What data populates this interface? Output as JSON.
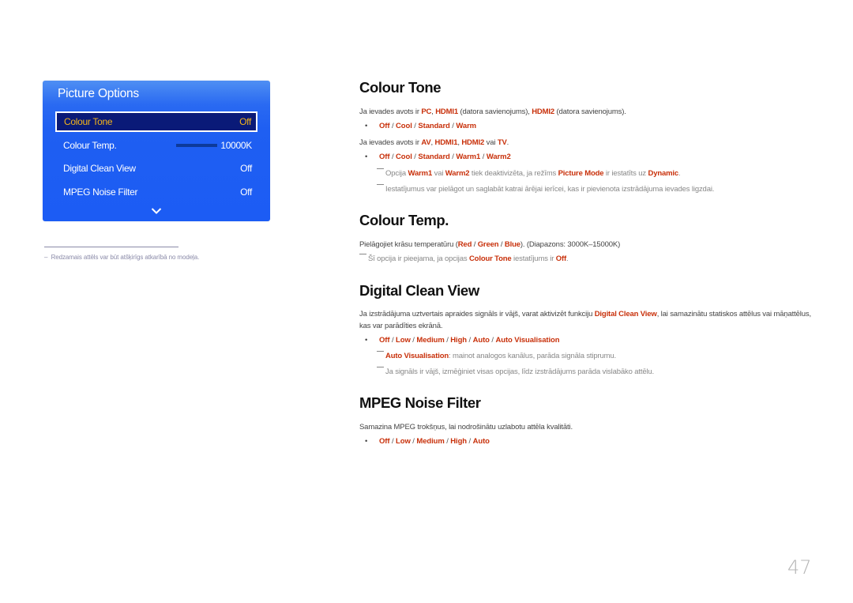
{
  "osd": {
    "title": "Picture Options",
    "items": [
      {
        "label": "Colour Tone",
        "value": "Off",
        "selected": true
      },
      {
        "label": "Colour Temp.",
        "value": "10000K",
        "slider_fraction": 1.0
      },
      {
        "label": "Digital Clean View",
        "value": "Off"
      },
      {
        "label": "MPEG Noise Filter",
        "value": "Off"
      }
    ],
    "more_icon": "chevron-down-icon"
  },
  "footnote": {
    "dash": "–",
    "text": "Redzamais attēls var būt atšķirīgs atkarībā no modeļa."
  },
  "sections": {
    "colour_tone": {
      "heading": "Colour Tone",
      "line1": {
        "t1": "Ja ievades avots ir ",
        "h1": "PC",
        "t2": ", ",
        "h2": "HDMI1",
        "t3": " (datora savienojums), ",
        "h3": "HDMI2",
        "t4": " (datora savienojums)."
      },
      "options1": [
        "Off",
        "Cool",
        "Standard",
        "Warm"
      ],
      "line2": {
        "t1": "Ja ievades avots ir ",
        "h1": "AV",
        "t2": ", ",
        "h2": "HDMI1",
        "t3": ", ",
        "h3": "HDMI2",
        "t4": " vai ",
        "h4": "TV",
        "t5": "."
      },
      "options2": [
        "Off",
        "Cool",
        "Standard",
        "Warm1",
        "Warm2"
      ],
      "note1": {
        "t1": "Opcija ",
        "h1": "Warm1",
        "t2": " vai ",
        "h2": "Warm2",
        "t3": " tiek deaktivizēta, ja režīms ",
        "h3": "Picture Mode",
        "t4": " ir iestatīts uz ",
        "h4": "Dynamic",
        "t5": "."
      },
      "note2": "Iestatījumus var pielāgot un saglabāt katrai ārējai ierīcei, kas ir pievienota izstrādājuma ievades ligzdai."
    },
    "colour_temp": {
      "heading": "Colour Temp.",
      "line1": {
        "t1": "Pielāgojiet krāsu temperatūru (",
        "h1": "Red",
        "t2": " / ",
        "h2": "Green",
        "t3": " / ",
        "h3": "Blue",
        "t4": "). (Diapazons: 3000K–15000K)"
      },
      "note1": {
        "t1": "Šī opcija ir pieejama, ja opcijas ",
        "h1": "Colour Tone",
        "t2": " iestatījums ir ",
        "h2": "Off",
        "t3": "."
      }
    },
    "digital_clean_view": {
      "heading": "Digital Clean View",
      "para": {
        "t1": "Ja izstrādājuma uztvertais apraides signāls ir vājš, varat aktivizēt funkciju ",
        "h1": "Digital Clean View",
        "t2": ", lai samazinātu statiskos attēlus vai māņattēlus, kas var parādīties ekrānā."
      },
      "options": [
        "Off",
        "Low",
        "Medium",
        "High",
        "Auto",
        "Auto Visualisation"
      ],
      "note1": {
        "h1": "Auto Visualisation",
        "t1": ": mainot analogos kanālus, parāda signāla stiprumu."
      },
      "note2": "Ja signāls ir vājš, izmēģiniet visas opcijas, līdz izstrādājums parāda vislabāko attēlu."
    },
    "mpeg_noise_filter": {
      "heading": "MPEG Noise Filter",
      "line1": "Samazina MPEG trokšņus, lai nodrošinātu uzlabotu attēla kvalitāti.",
      "options": [
        "Off",
        "Low",
        "Medium",
        "High",
        "Auto"
      ]
    }
  },
  "bullet_glyph": "•",
  "option_separator": " / ",
  "page_number": "47",
  "colors": {
    "highlight": "#c8300a",
    "osd_blue": "#1f5ff2",
    "osd_selected_bg": "#0a1a78",
    "osd_selected_text": "#f4b41a"
  }
}
